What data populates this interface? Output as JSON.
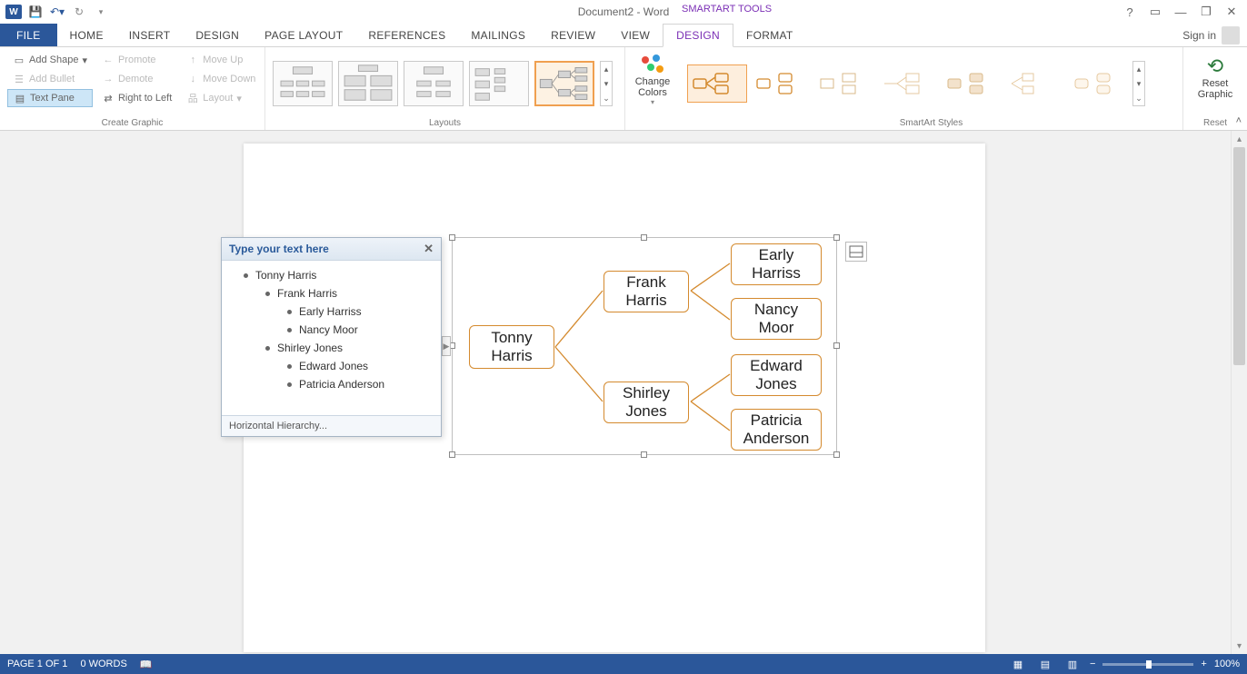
{
  "title": "Document2 - Word",
  "tool_context": "SMARTART TOOLS",
  "qat": {
    "save": "💾",
    "undo": "↶",
    "redo": "↻"
  },
  "window": {
    "help": "?",
    "opts": "▭",
    "min": "—",
    "restore": "❐",
    "close": "✕"
  },
  "tabs": {
    "file": "FILE",
    "home": "HOME",
    "insert": "INSERT",
    "design_main": "DESIGN",
    "page_layout": "PAGE LAYOUT",
    "references": "REFERENCES",
    "mailings": "MAILINGS",
    "review": "REVIEW",
    "view": "VIEW",
    "design": "DESIGN",
    "format": "FORMAT"
  },
  "signin": "Sign in",
  "ribbon": {
    "create_graphic": {
      "add_shape": "Add Shape",
      "add_bullet": "Add Bullet",
      "text_pane": "Text Pane",
      "promote": "Promote",
      "demote": "Demote",
      "right_to_left": "Right to Left",
      "move_up": "Move Up",
      "move_down": "Move Down",
      "layout": "Layout",
      "label": "Create Graphic"
    },
    "layouts": {
      "label": "Layouts"
    },
    "change_colors": "Change Colors",
    "styles": {
      "label": "SmartArt Styles"
    },
    "reset": {
      "btn": "Reset Graphic",
      "label": "Reset"
    }
  },
  "text_pane": {
    "header": "Type your text here",
    "items": [
      {
        "level": 0,
        "text": "Tonny Harris"
      },
      {
        "level": 1,
        "text": "Frank Harris"
      },
      {
        "level": 2,
        "text": "Early Harriss"
      },
      {
        "level": 2,
        "text": "Nancy Moor"
      },
      {
        "level": 1,
        "text": "Shirley Jones"
      },
      {
        "level": 2,
        "text": "Edward Jones"
      },
      {
        "level": 2,
        "text": "Patricia Anderson"
      }
    ],
    "footer": "Horizontal Hierarchy..."
  },
  "smartart": {
    "root": "Tonny Harris",
    "mid1": "Frank Harris",
    "mid2": "Shirley Jones",
    "leaf1": "Early Harriss",
    "leaf2": "Nancy Moor",
    "leaf3": "Edward Jones",
    "leaf4": "Patricia Anderson"
  },
  "status": {
    "page": "PAGE 1 OF 1",
    "words": "0 WORDS",
    "zoom": "100%"
  }
}
